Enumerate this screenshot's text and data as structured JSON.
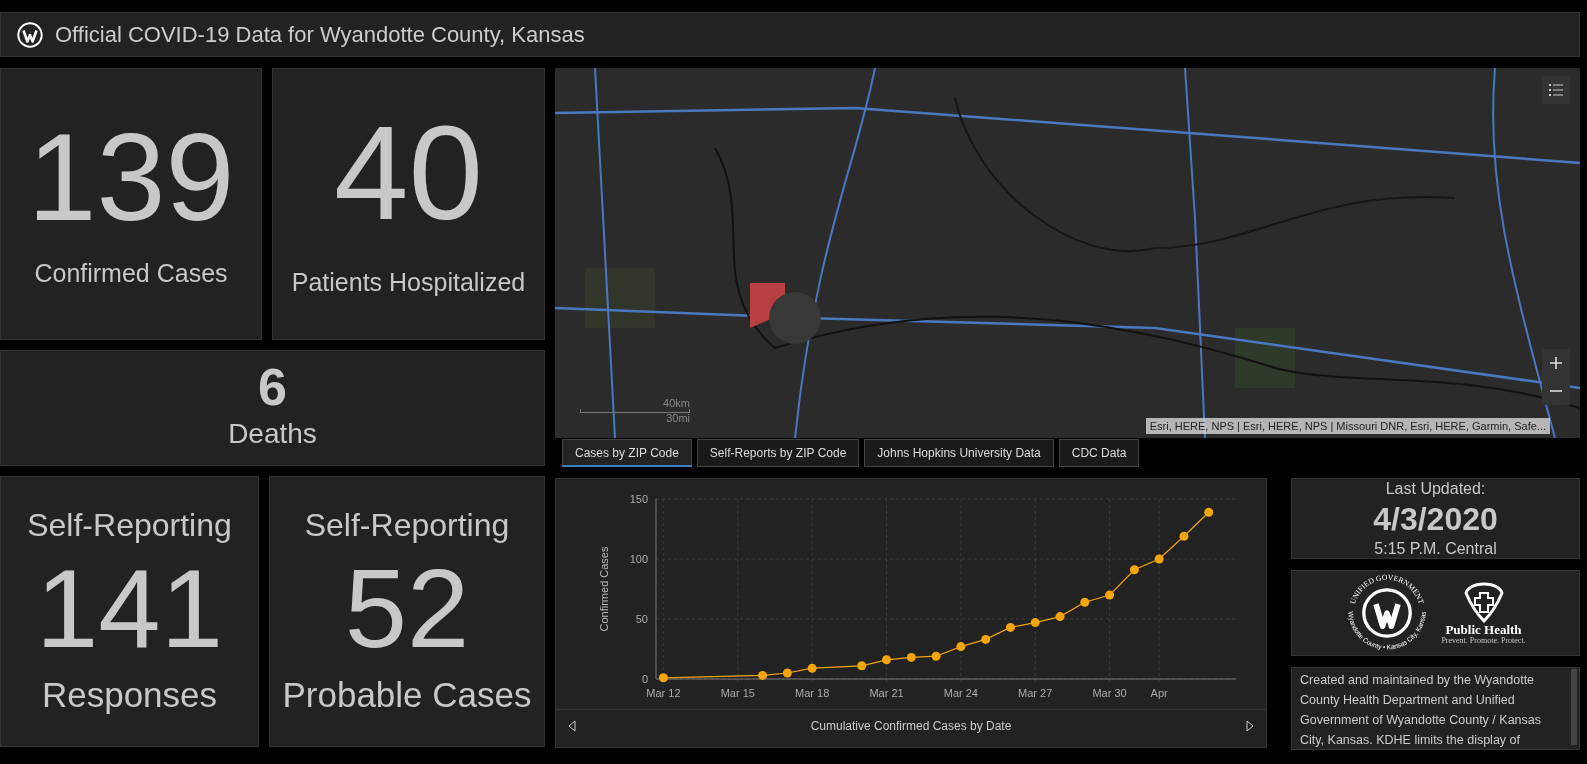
{
  "header": {
    "title": "Official COVID-19 Data for Wyandotte County, Kansas"
  },
  "stats": [
    {
      "value": "139",
      "label": "Confirmed Cases"
    },
    {
      "value": "40",
      "label": "Patients Hospitalized"
    },
    {
      "value": "6",
      "label": "Deaths"
    },
    {
      "top": "Self-Reporting",
      "value": "141",
      "label": "Responses"
    },
    {
      "top": "Self-Reporting",
      "value": "52",
      "label": "Probable Cases"
    }
  ],
  "map": {
    "scale_km": "40km",
    "scale_mi": "30mi",
    "attribution": "Esri, HERE, NPS | Esri, HERE, NPS | Missouri DNR, Esri, HERE, Garmin, Safe..."
  },
  "tabs": [
    {
      "label": "Cases by ZIP Code",
      "selected": true
    },
    {
      "label": "Self-Reports by ZIP Code",
      "selected": false
    },
    {
      "label": "Johns Hopkins University Data",
      "selected": false
    },
    {
      "label": "CDC Data",
      "selected": false
    }
  ],
  "chart": {
    "chart_data": {
      "type": "line",
      "grid": true,
      "title": "Cumulative Confirmed Cases by Date",
      "ylabel": "Confirmed Cases",
      "categories": [
        "Mar 12",
        null,
        null,
        "Mar 15",
        null,
        null,
        "Mar 18",
        null,
        null,
        "Mar 21",
        null,
        null,
        "Mar 24",
        null,
        null,
        "Mar 27",
        null,
        null,
        "Mar 30",
        null,
        "Apr",
        null,
        null
      ],
      "series": [
        {
          "marker": "circle",
          "color": "#f5a50a",
          "values": [
            1,
            null,
            null,
            null,
            3,
            5,
            9,
            null,
            11,
            16,
            18,
            19,
            27,
            33,
            43,
            47,
            52,
            64,
            70,
            91,
            100,
            119,
            139
          ]
        }
      ],
      "ylim": [
        0,
        150
      ],
      "yticks": [
        0,
        50,
        100,
        150
      ]
    }
  },
  "updated": {
    "heading": "Last Updated:",
    "date": "4/3/2020",
    "time": "5:15 P.M. Central"
  },
  "logos": {
    "ring_top": "UNIFIED GOVERNMENT",
    "ring_bottom": "Wyandotte County • Kansas City, Kansas",
    "health_name": "Public Health",
    "health_tagline": "Prevent. Promote. Protect."
  },
  "note": "Created and maintained by the Wyandotte County Health Department and Unified Government of Wyandotte County / Kansas City, Kansas. KDHE limits the display of"
}
